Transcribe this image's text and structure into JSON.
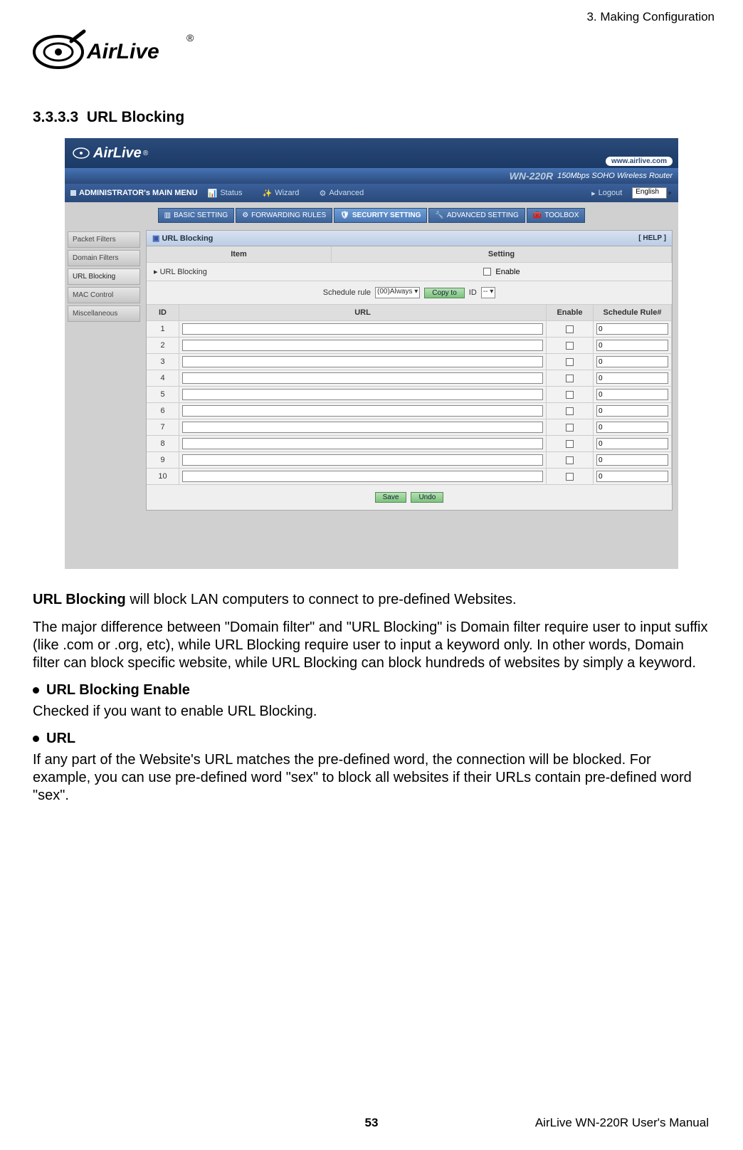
{
  "header": {
    "chapter": "3. Making Configuration"
  },
  "logo": {
    "brand_top": "AirLive",
    "registered": "®"
  },
  "section": {
    "number": "3.3.3.3",
    "title": "URL Blocking"
  },
  "screenshot": {
    "top": {
      "brand": "AirLive",
      "url_badge": "www.airlive.com",
      "model": "WN-220R",
      "model_desc": "150Mbps SOHO Wireless Router"
    },
    "menubar": {
      "admin": "ADMINISTRATOR's MAIN MENU",
      "items": [
        "Status",
        "Wizard",
        "Advanced"
      ],
      "logout": "Logout",
      "language": "English"
    },
    "tabs": [
      "BASIC SETTING",
      "FORWARDING RULES",
      "SECURITY SETTING",
      "ADVANCED SETTING",
      "TOOLBOX"
    ],
    "sidebar": [
      "Packet Filters",
      "Domain Filters",
      "URL Blocking",
      "MAC Control",
      "Miscellaneous"
    ],
    "panel": {
      "title": "URL Blocking",
      "help": "[ HELP ]",
      "headers": {
        "item": "Item",
        "setting": "Setting"
      },
      "enable_label": "URL Blocking",
      "enable_field": "Enable",
      "schedule": {
        "label": "Schedule rule",
        "option": "(00)Always",
        "copy": "Copy to",
        "id_label": "ID",
        "id_value": "--"
      },
      "grid_headers": {
        "id": "ID",
        "url": "URL",
        "enable": "Enable",
        "sched": "Schedule Rule#"
      },
      "rows": [
        {
          "id": "1",
          "url": "",
          "enable": false,
          "sched": "0"
        },
        {
          "id": "2",
          "url": "",
          "enable": false,
          "sched": "0"
        },
        {
          "id": "3",
          "url": "",
          "enable": false,
          "sched": "0"
        },
        {
          "id": "4",
          "url": "",
          "enable": false,
          "sched": "0"
        },
        {
          "id": "5",
          "url": "",
          "enable": false,
          "sched": "0"
        },
        {
          "id": "6",
          "url": "",
          "enable": false,
          "sched": "0"
        },
        {
          "id": "7",
          "url": "",
          "enable": false,
          "sched": "0"
        },
        {
          "id": "8",
          "url": "",
          "enable": false,
          "sched": "0"
        },
        {
          "id": "9",
          "url": "",
          "enable": false,
          "sched": "0"
        },
        {
          "id": "10",
          "url": "",
          "enable": false,
          "sched": "0"
        }
      ],
      "buttons": {
        "save": "Save",
        "undo": "Undo"
      }
    }
  },
  "paragraphs": {
    "p1a": "URL Blocking",
    "p1b": " will block LAN computers to connect to pre-defined Websites.",
    "p2": "The major difference between \"Domain filter\" and \"URL Blocking\" is Domain filter require user to input suffix (like .com or .org, etc), while URL Blocking require user to input a keyword only. In other words, Domain filter can block specific website, while URL Blocking can block hundreds of websites by simply a keyword.",
    "b1": "URL Blocking Enable",
    "b1_desc": "Checked if you want to enable URL Blocking.",
    "b2": "URL",
    "b2_desc": "If any part of the Website's URL matches the pre-defined word, the connection will be blocked. For example, you can use pre-defined word \"sex\" to block all websites if their URLs contain pre-defined word \"sex\"."
  },
  "footer": {
    "page": "53",
    "doc": "AirLive WN-220R User's Manual"
  }
}
